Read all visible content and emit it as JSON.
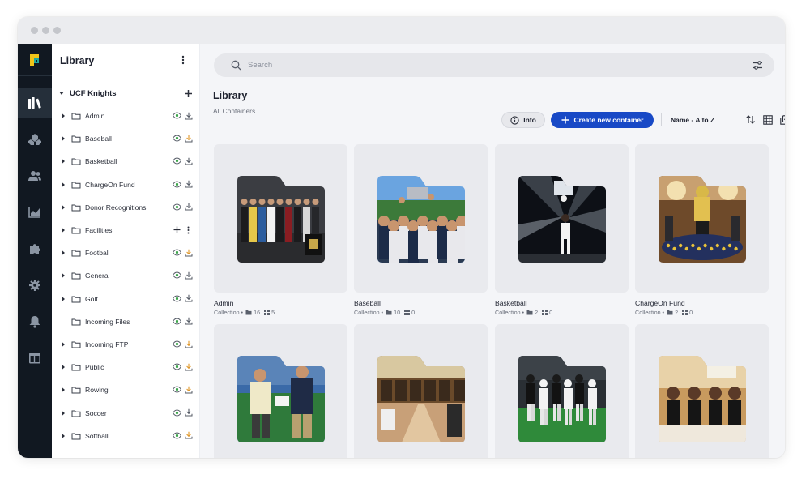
{
  "sidebar": {
    "title": "Library",
    "root": {
      "label": "UCF Knights"
    },
    "items": [
      {
        "label": "Admin",
        "has_children": true,
        "actions": [
          "eye-icon",
          "download-icon"
        ],
        "download_highlight": false
      },
      {
        "label": "Baseball",
        "has_children": true,
        "actions": [
          "eye-icon",
          "download-icon"
        ],
        "download_highlight": true
      },
      {
        "label": "Basketball",
        "has_children": true,
        "actions": [
          "eye-icon",
          "download-icon"
        ],
        "download_highlight": false
      },
      {
        "label": "ChargeOn Fund",
        "has_children": true,
        "actions": [
          "eye-icon",
          "download-icon"
        ],
        "download_highlight": false
      },
      {
        "label": "Donor Recognitions",
        "has_children": true,
        "actions": [
          "eye-icon",
          "download-icon"
        ],
        "download_highlight": false
      },
      {
        "label": "Facilities",
        "has_children": true,
        "actions": [
          "plus-icon",
          "more-vertical-icon"
        ],
        "download_highlight": false
      },
      {
        "label": "Football",
        "has_children": true,
        "actions": [
          "eye-icon",
          "download-icon"
        ],
        "download_highlight": true
      },
      {
        "label": "General",
        "has_children": true,
        "actions": [
          "eye-icon",
          "download-icon"
        ],
        "download_highlight": false
      },
      {
        "label": "Golf",
        "has_children": true,
        "actions": [
          "eye-icon",
          "download-icon"
        ],
        "download_highlight": false
      },
      {
        "label": "Incoming Files",
        "has_children": false,
        "actions": [
          "eye-icon",
          "download-icon"
        ],
        "download_highlight": false
      },
      {
        "label": "Incoming FTP",
        "has_children": true,
        "actions": [
          "eye-icon",
          "download-icon"
        ],
        "download_highlight": true
      },
      {
        "label": "Public",
        "has_children": true,
        "actions": [
          "eye-icon",
          "download-icon"
        ],
        "download_highlight": true
      },
      {
        "label": "Rowing",
        "has_children": true,
        "actions": [
          "eye-icon",
          "download-icon"
        ],
        "download_highlight": true
      },
      {
        "label": "Soccer",
        "has_children": true,
        "actions": [
          "eye-icon",
          "download-icon"
        ],
        "download_highlight": false
      },
      {
        "label": "Softball",
        "has_children": true,
        "actions": [
          "eye-icon",
          "download-icon"
        ],
        "download_highlight": true
      }
    ]
  },
  "rail": {
    "items": [
      "library-icon",
      "shapes-icon",
      "users-icon",
      "chart-icon",
      "puzzle-icon",
      "gear-icon",
      "bell-icon",
      "layout-icon"
    ],
    "active": "library-icon"
  },
  "search": {
    "placeholder": "Search"
  },
  "main": {
    "title": "Library",
    "subtitle": "All Containers",
    "info_label": "Info",
    "create_label": "Create new container",
    "sort_label": "Name - A to Z"
  },
  "cards": [
    {
      "name": "Admin",
      "type": "Collection •",
      "folders": "16",
      "items": "5",
      "photo": "people-group"
    },
    {
      "name": "Baseball",
      "type": "Collection •",
      "folders": "10",
      "items": "0",
      "photo": "team-celebration"
    },
    {
      "name": "Basketball",
      "type": "Collection •",
      "folders": "2",
      "items": "0",
      "photo": "player-spotlight"
    },
    {
      "name": "ChargeOn Fund",
      "type": "Collection •",
      "folders": "2",
      "items": "0",
      "photo": "banquet-mascot"
    },
    {
      "name": "",
      "type": "",
      "folders": "",
      "items": "",
      "photo": "handshake-field"
    },
    {
      "name": "",
      "type": "",
      "folders": "",
      "items": "",
      "photo": "locker-room"
    },
    {
      "name": "",
      "type": "",
      "folders": "",
      "items": "",
      "photo": "football-game"
    },
    {
      "name": "",
      "type": "",
      "folders": "",
      "items": "",
      "photo": "players-table"
    }
  ],
  "colors": {
    "accent": "#1849c6",
    "rail_bg": "#111821",
    "eye_green": "#3ca64a",
    "download_orange": "#e0982b",
    "brand_yellow": "#f0c419",
    "brand_teal": "#1fa8a0"
  }
}
